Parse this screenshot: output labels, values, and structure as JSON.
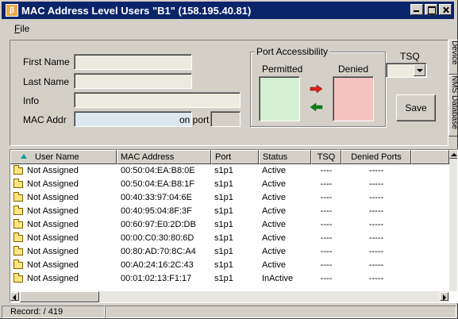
{
  "window": {
    "title": "MAC Address Level Users \"B1\" (158.195.40.81)",
    "icon_letter": "β"
  },
  "menu": {
    "file_first": "F",
    "file_rest": "ile"
  },
  "form": {
    "first_name_label": "First Name",
    "last_name_label": "Last Name",
    "info_label": "Info",
    "mac_addr_label": "MAC Addr",
    "on_port_label": "on port",
    "first_name_value": "",
    "last_name_value": "",
    "info_value": "",
    "mac_value": "",
    "port_value": ""
  },
  "port_access": {
    "title": "Port Accessibility",
    "permitted_label": "Permitted",
    "denied_label": "Denied",
    "move_right_color": "#e02020",
    "move_left_color": "#108010"
  },
  "tsq": {
    "label": "TSQ",
    "selected": ""
  },
  "save_label": "Save",
  "side_tabs": [
    "Device",
    "NMS Database"
  ],
  "grid": {
    "columns": [
      "User Name",
      "MAC Address",
      "Port",
      "Status",
      "TSQ",
      "Denied Ports"
    ],
    "rows": [
      {
        "name": "Not Assigned",
        "mac": "00:50:04:EA:B8:0E",
        "port": "s1p1",
        "status": "Active",
        "tsq": "----",
        "denied": "-----"
      },
      {
        "name": "Not Assigned",
        "mac": "00:50:04:EA:B8:1F",
        "port": "s1p1",
        "status": "Active",
        "tsq": "----",
        "denied": "-----"
      },
      {
        "name": "Not Assigned",
        "mac": "00:40:33:97:04:6E",
        "port": "s1p1",
        "status": "Active",
        "tsq": "----",
        "denied": "-----"
      },
      {
        "name": "Not Assigned",
        "mac": "00:40:95:04:8F:3F",
        "port": "s1p1",
        "status": "Active",
        "tsq": "----",
        "denied": "-----"
      },
      {
        "name": "Not Assigned",
        "mac": "00:60:97:E0:2D:DB",
        "port": "s1p1",
        "status": "Active",
        "tsq": "----",
        "denied": "-----"
      },
      {
        "name": "Not Assigned",
        "mac": "00:00:C0:30:80:6D",
        "port": "s1p1",
        "status": "Active",
        "tsq": "----",
        "denied": "-----"
      },
      {
        "name": "Not Assigned",
        "mac": "00:80:AD:70:8C:A4",
        "port": "s1p1",
        "status": "Active",
        "tsq": "----",
        "denied": "-----"
      },
      {
        "name": "Not Assigned",
        "mac": "00:A0:24:16:2C:43",
        "port": "s1p1",
        "status": "Active",
        "tsq": "----",
        "denied": "-----"
      },
      {
        "name": "Not Assigned",
        "mac": "00:01:02:13:F1:17",
        "port": "s1p1",
        "status": "InActive",
        "tsq": "----",
        "denied": "-----"
      }
    ]
  },
  "status_bar": {
    "record_label": "Record:",
    "record_value": "/ 419"
  }
}
